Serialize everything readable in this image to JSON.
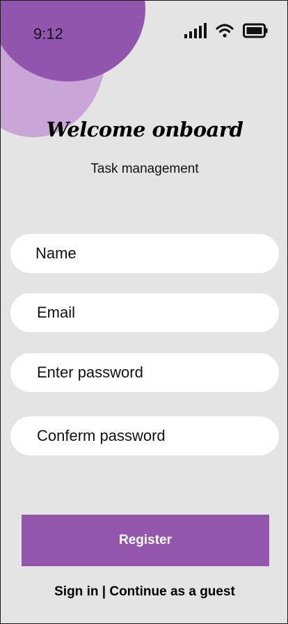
{
  "status": {
    "time": "9:12"
  },
  "header": {
    "title": "Welcome onboard",
    "subtitle": "Task management"
  },
  "form": {
    "name_placeholder": "Name",
    "email_placeholder": "Email",
    "password_placeholder": "Enter password",
    "confirm_placeholder": "Conferm password"
  },
  "actions": {
    "register_label": "Register",
    "sign_in_label": "Sign in",
    "separator": "|",
    "guest_label": "Continue as a guest"
  },
  "colors": {
    "accent": "#9455ad",
    "accent_light": "#c9a5d8",
    "background": "#e4e4e4",
    "field": "#ffffff"
  },
  "icons": [
    "signal-icon",
    "wifi-icon",
    "battery-icon"
  ]
}
